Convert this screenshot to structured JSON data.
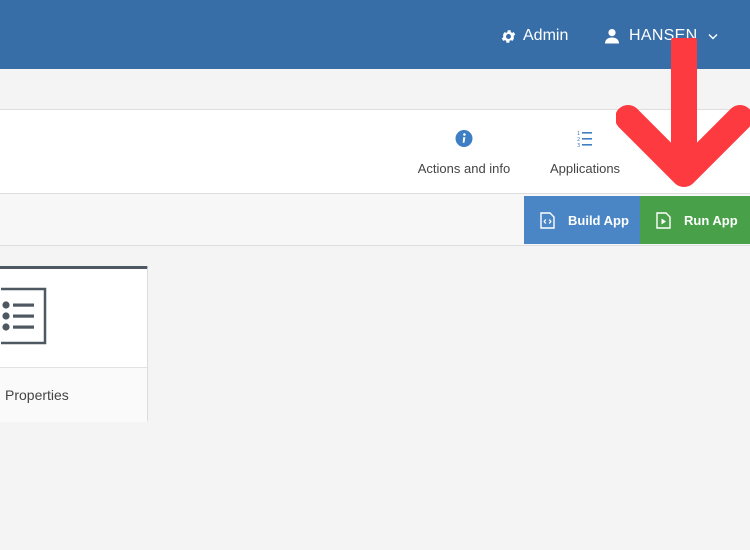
{
  "header": {
    "admin_label": "Admin",
    "user_name": "HANSEN",
    "icons": {
      "admin": "gear-icon",
      "user": "user-icon",
      "user_menu": "chevron-down-icon"
    }
  },
  "toolbar": {
    "items": [
      {
        "label": "Actions and info",
        "icon": "info-icon"
      },
      {
        "label": "Applications",
        "icon": "numbered-list-icon"
      },
      {
        "label": "",
        "icon": ""
      }
    ]
  },
  "actions": {
    "build_label": "Build App",
    "run_label": "Run App",
    "build_icon": "code-file-icon",
    "run_icon": "play-file-icon"
  },
  "card": {
    "label": "Properties",
    "icon": "bulleted-list-icon"
  },
  "annotation": {
    "icon": "red-down-arrow"
  },
  "colors": {
    "header_bg": "#386ea8",
    "build_button": "#4a86c5",
    "run_button": "#48a148",
    "info_icon": "#3e7ec4",
    "annotation_arrow": "#fc3a40",
    "page_bg": "#f4f4f4"
  }
}
